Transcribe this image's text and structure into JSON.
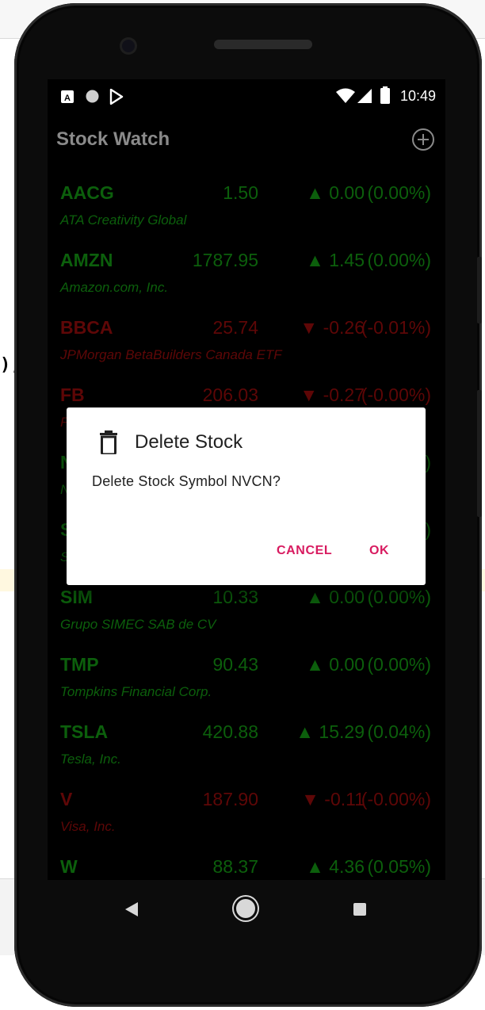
{
  "background": {
    "code_fragment": ");"
  },
  "status_bar": {
    "time": "10:49"
  },
  "app_bar": {
    "title": "Stock Watch"
  },
  "stocks": [
    {
      "symbol": "AACG",
      "price": "1.50",
      "change": "▲ 0.00",
      "percent": "(0.00%)",
      "name": "ATA Creativity Global",
      "direction": "up"
    },
    {
      "symbol": "AMZN",
      "price": "1787.95",
      "change": "▲ 1.45",
      "percent": "(0.00%)",
      "name": "Amazon.com, Inc.",
      "direction": "up"
    },
    {
      "symbol": "BBCA",
      "price": "25.74",
      "change": "▼ -0.26",
      "percent": "(-0.01%)",
      "name": "JPMorgan BetaBuilders Canada ETF",
      "direction": "down"
    },
    {
      "symbol": "FB",
      "price": "206.03",
      "change": "▼ -0.27",
      "percent": "(-0.00%)",
      "name": "F",
      "direction": "down"
    },
    {
      "symbol": "N",
      "price": "",
      "change": "",
      "percent": ")",
      "name": "N",
      "direction": "up"
    },
    {
      "symbol": "S",
      "price": "",
      "change": "",
      "percent": ")",
      "name": "S",
      "direction": "up"
    },
    {
      "symbol": "SIM",
      "price": "10.33",
      "change": "▲ 0.00",
      "percent": "(0.00%)",
      "name": "Grupo SIMEC SAB de CV",
      "direction": "up"
    },
    {
      "symbol": "TMP",
      "price": "90.43",
      "change": "▲ 0.00",
      "percent": "(0.00%)",
      "name": "Tompkins Financial Corp.",
      "direction": "up"
    },
    {
      "symbol": "TSLA",
      "price": "420.88",
      "change": "▲ 15.29",
      "percent": "(0.04%)",
      "name": "Tesla, Inc.",
      "direction": "up"
    },
    {
      "symbol": "V",
      "price": "187.90",
      "change": "▼ -0.11",
      "percent": "(-0.00%)",
      "name": "Visa, Inc.",
      "direction": "down"
    },
    {
      "symbol": "W",
      "price": "88.37",
      "change": "▲ 4.36",
      "percent": "(0.05%)",
      "name": "",
      "direction": "up"
    }
  ],
  "dialog": {
    "title": "Delete Stock",
    "message": "Delete Stock Symbol NVCN?",
    "cancel_label": "CANCEL",
    "ok_label": "OK",
    "icon": "trash-icon"
  },
  "colors": {
    "up": "#0c5f0c",
    "down": "#5e0707",
    "accent": "#d81b60"
  }
}
